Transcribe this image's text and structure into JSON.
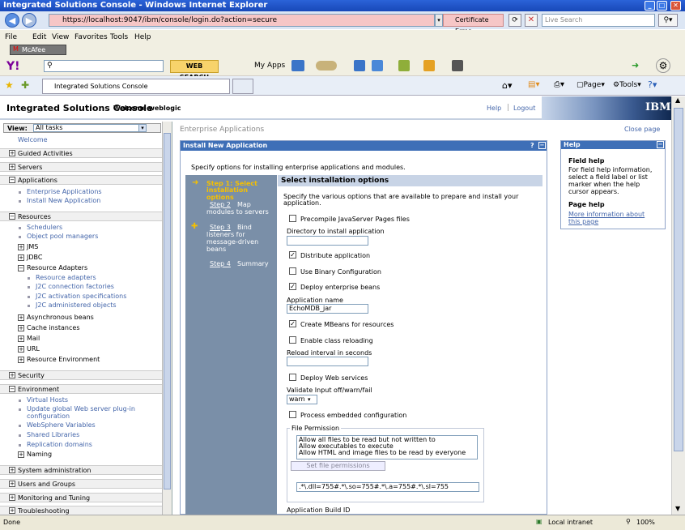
{
  "window": {
    "title": "Integrated Solutions Console - Windows Internet Explorer"
  },
  "browser": {
    "url": "https://localhost:9047/ibm/console/login.do?action=secure",
    "cert_error": "Certificate Error",
    "live_search_placeholder": "Live Search",
    "menus": [
      "File",
      "Edit",
      "View",
      "Favorites",
      "Tools",
      "Help"
    ],
    "mcafee": "McAfee",
    "web_search": "WEB SEARCH",
    "my_apps": "My Apps",
    "tab_title": "Integrated Solutions Console",
    "page_menu": "Page",
    "tools_menu": "Tools"
  },
  "console": {
    "title": "Integrated Solutions Console",
    "welcome": "Welcome weblogic",
    "help_link": "Help",
    "logout_link": "Logout",
    "brand": "IBM."
  },
  "nav": {
    "view_label": "View:",
    "view_value": "All tasks",
    "welcome": "Welcome",
    "items": {
      "guided": "Guided Activities",
      "servers": "Servers",
      "applications": "Applications",
      "enterprise_apps": "Enterprise Applications",
      "install_new": "Install New Application",
      "resources": "Resources",
      "schedulers": "Schedulers",
      "object_pool": "Object pool managers",
      "jms": "JMS",
      "jdbc": "JDBC",
      "resource_adapters": "Resource Adapters",
      "res_adapters": "Resource adapters",
      "j2c_cf": "J2C connection factories",
      "j2c_as": "J2C activation specifications",
      "j2c_ao": "J2C administered objects",
      "async_beans": "Asynchronous beans",
      "cache": "Cache instances",
      "mail": "Mail",
      "url": "URL",
      "res_env": "Resource Environment",
      "security": "Security",
      "environment": "Environment",
      "virtual_hosts": "Virtual Hosts",
      "update_plugin_1": "Update global Web server plug-in",
      "update_plugin_2": "configuration",
      "ws_vars": "WebSphere Variables",
      "shared_libs": "Shared Libraries",
      "replication": "Replication domains",
      "naming": "Naming",
      "sysadmin": "System administration",
      "users_groups": "Users and Groups",
      "monitoring": "Monitoring and Tuning",
      "troubleshooting": "Troubleshooting"
    }
  },
  "main": {
    "breadcrumb": "Enterprise Applications",
    "close_page": "Close page",
    "panel_title": "Install New Application",
    "panel_q": "?",
    "intro": "Specify options for installing enterprise applications and modules.",
    "steps": {
      "s1_a": "Step 1: Select",
      "s1_b": "installation options",
      "s2_a": "Step 2",
      "s2_b": "Map",
      "s2_c": "modules to servers",
      "s3_a": "Step 3",
      "s3_b": "Bind",
      "s3_c": "listeners for",
      "s3_d": "message-driven",
      "s3_e": "beans",
      "s4_a": "Step 4",
      "s4_b": "Summary"
    },
    "options_title": "Select installation options",
    "options_desc_1": "Specify the various options that are available to prepare and install your",
    "options_desc_2": "application.",
    "precompile": "Precompile JavaServer Pages files",
    "dir_label": "Directory to install application",
    "distribute": "Distribute application",
    "binary_config": "Use Binary Configuration",
    "deploy_ejb": "Deploy enterprise beans",
    "app_name_label": "Application name",
    "app_name_value": "EchoMDB_jar",
    "create_mbeans": "Create MBeans for resources",
    "class_reload": "Enable class reloading",
    "reload_interval": "Reload interval in seconds",
    "deploy_ws": "Deploy Web services",
    "validate_label": "Validate Input off/warn/fail",
    "validate_value": "warn",
    "process_embedded": "Process embedded configuration",
    "file_permission": "File Permission",
    "perm_opts": [
      "Allow all files to be read but not written to",
      "Allow executables to execute",
      "Allow HTML and image files to be read by everyone"
    ],
    "set_perms": "Set file permissions",
    "perm_value": ".*\\.dll=755#.*\\.so=755#.*\\.a=755#.*\\.sl=755",
    "build_id": "Application Build ID"
  },
  "help": {
    "title": "Help",
    "field_help": "Field help",
    "field_text_1": "For field help information,",
    "field_text_2": "select a field label or list",
    "field_text_3": "marker when the help",
    "field_text_4": "cursor appears.",
    "page_help": "Page help",
    "more_1": "More information about",
    "more_2": "this page"
  },
  "status": {
    "done": "Done",
    "zone": "Local intranet",
    "zoom": "100%"
  }
}
